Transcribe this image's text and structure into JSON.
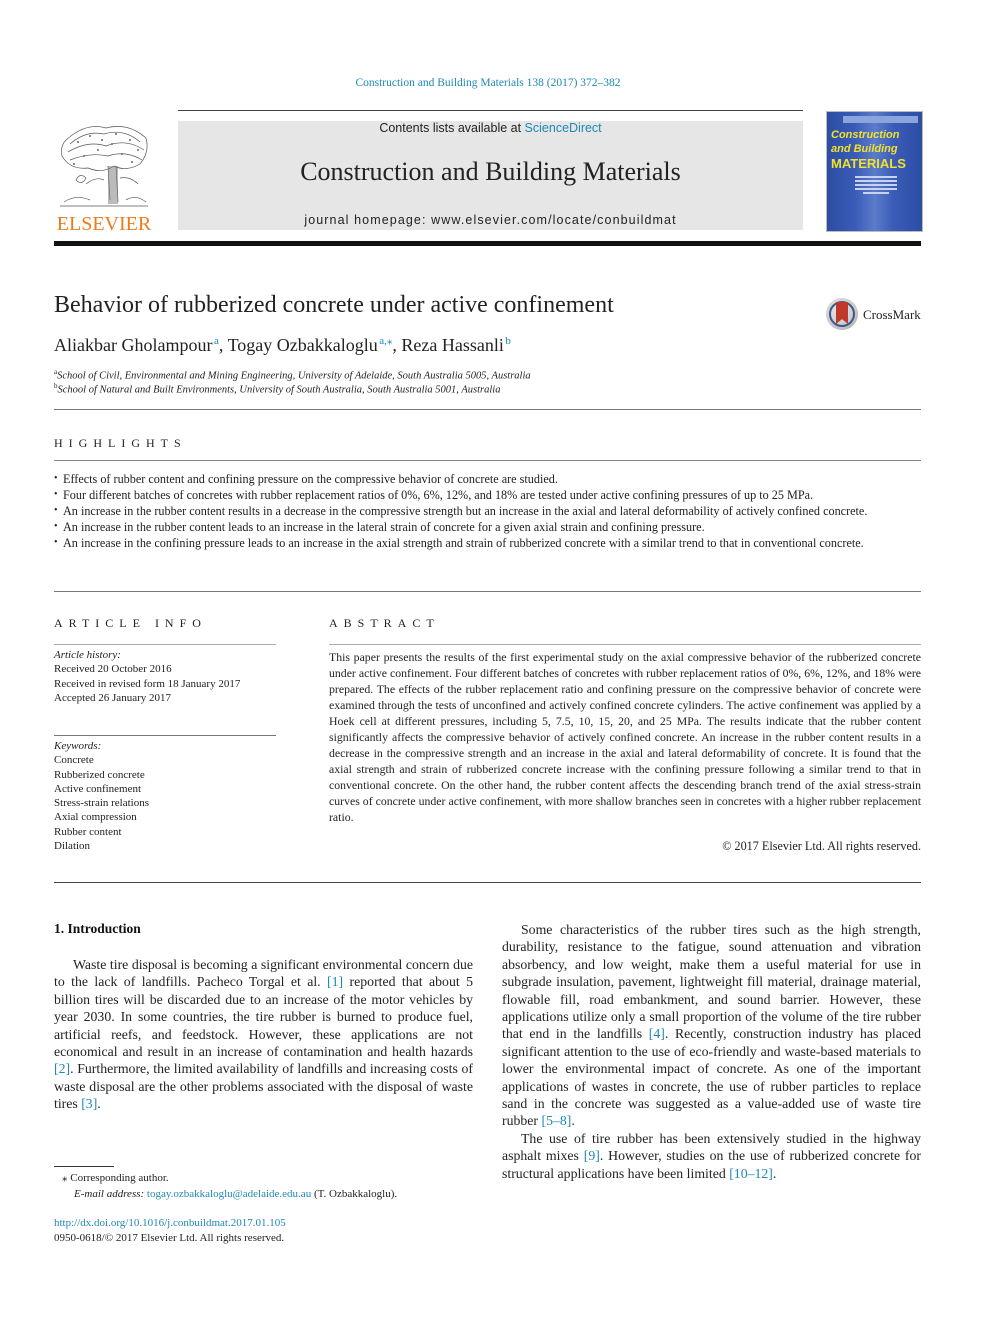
{
  "running_head": "Construction and Building Materials 138 (2017) 372–382",
  "masthead": {
    "contents_prefix": "Contents lists available at ",
    "contents_link": "ScienceDirect",
    "journal_name": "Construction and Building Materials",
    "homepage_label": "journal homepage: www.elsevier.com/locate/conbuildmat",
    "publisher_logo_text": "ELSEVIER",
    "cover": {
      "line1": "Construction",
      "line2": "and Building",
      "line3": "MATERIALS"
    }
  },
  "crossmark_label": "CrossMark",
  "article": {
    "title": "Behavior of rubberized concrete under active confinement",
    "authors": [
      {
        "name": "Aliakbar Gholampour",
        "sup": "a"
      },
      {
        "name": "Togay Ozbakkaloglu",
        "sup": "a,⁎"
      },
      {
        "name": "Reza Hassanli",
        "sup": "b"
      }
    ],
    "affiliations": [
      {
        "sup": "a",
        "text": "School of Civil, Environmental and Mining Engineering, University of Adelaide, South Australia 5005, Australia"
      },
      {
        "sup": "b",
        "text": "School of Natural and Built Environments, University of South Australia, South Australia 5001, Australia"
      }
    ]
  },
  "highlights": {
    "label": "HIGHLIGHTS",
    "items": [
      "Effects of rubber content and confining pressure on the compressive behavior of concrete are studied.",
      "Four different batches of concretes with rubber replacement ratios of 0%, 6%, 12%, and 18% are tested under active confining pressures of up to 25 MPa.",
      "An increase in the rubber content results in a decrease in the compressive strength but an increase in the axial and lateral deformability of actively confined concrete.",
      "An increase in the rubber content leads to an increase in the lateral strain of concrete for a given axial strain and confining pressure.",
      "An increase in the confining pressure leads to an increase in the axial strength and strain of rubberized concrete with a similar trend to that in conventional concrete."
    ]
  },
  "article_info": {
    "label": "ARTICLE INFO",
    "history_label": "Article history:",
    "history": [
      "Received 20 October 2016",
      "Received in revised form 18 January 2017",
      "Accepted 26 January 2017"
    ],
    "keywords_label": "Keywords:",
    "keywords": [
      "Concrete",
      "Rubberized concrete",
      "Active confinement",
      "Stress-strain relations",
      "Axial compression",
      "Rubber content",
      "Dilation"
    ]
  },
  "abstract": {
    "label": "ABSTRACT",
    "text": "This paper presents the results of the first experimental study on the axial compressive behavior of the rubberized concrete under active confinement. Four different batches of concretes with rubber replacement ratios of 0%, 6%, 12%, and 18% were prepared. The effects of the rubber replacement ratio and confining pressure on the compressive behavior of concrete were examined through the tests of unconfined and actively confined concrete cylinders. The active confinement was applied by a Hoek cell at different pressures, including 5, 7.5, 10, 15, 20, and 25 MPa. The results indicate that the rubber content significantly affects the compressive behavior of actively confined concrete. An increase in the rubber content results in a decrease in the compressive strength and an increase in the axial and lateral deformability of concrete. It is found that the axial strength and strain of rubberized concrete increase with the confining pressure following a similar trend to that in conventional concrete. On the other hand, the rubber content affects the descending branch trend of the axial stress-strain curves of concrete under active confinement, with more shallow branches seen in concretes with a higher rubber replacement ratio.",
    "copyright": "© 2017 Elsevier Ltd. All rights reserved."
  },
  "introduction": {
    "heading": "1. Introduction",
    "p1": {
      "a": "Waste tire disposal is becoming a significant environmental concern due to the lack of landfills. Pacheco Torgal et al. ",
      "ref1": "[1]",
      "b": " reported that about 5 billion tires will be discarded due to an increase of the motor vehicles by year 2030. In some countries, the tire rubber is burned to produce fuel, artificial reefs, and feedstock. However, these applications are not economical and result in an increase of contamination and health hazards ",
      "ref2": "[2]",
      "c": ". Furthermore, the limited availability of landfills and increasing costs of waste disposal are the other problems associated with the disposal of waste tires ",
      "ref3": "[3]",
      "d": "."
    },
    "p2": {
      "a": "Some characteristics of the rubber tires such as the high strength, durability, resistance to the fatigue, sound attenuation and vibration absorbency, and low weight, make them a useful material for use in subgrade insulation, pavement, lightweight fill material, drainage material, flowable fill, road embankment, and sound barrier. However, these applications utilize only a small proportion of the volume of the tire rubber that end in the landfills ",
      "ref1": "[4]",
      "b": ". Recently, construction industry has placed significant attention to the use of eco-friendly and waste-based materials to lower the environmental impact of concrete. As one of the important applications of wastes in concrete, the use of rubber particles to replace sand in the concrete was suggested as a value-added use of waste tire rubber ",
      "ref2": "[5–8]",
      "c": "."
    },
    "p3": {
      "a": "The use of tire rubber has been extensively studied in the highway asphalt mixes ",
      "ref1": "[9]",
      "b": ". However, studies on the use of rubberized concrete for structural applications have been limited ",
      "ref2": "[10–12]",
      "c": "."
    }
  },
  "footnote": {
    "marker": "⁎",
    "corresponding": "Corresponding author.",
    "email_label": "E-mail address: ",
    "email": "togay.ozbakkaloglu@adelaide.edu.au",
    "email_suffix": " (T. Ozbakkaloglu)."
  },
  "doi": {
    "url": "http://dx.doi.org/10.1016/j.conbuildmat.2017.01.105",
    "issn_line": "0950-0618/© 2017 Elsevier Ltd. All rights reserved."
  },
  "colors": {
    "link": "#1e88b4",
    "elsevier_orange": "#f07a1a",
    "masthead_bg": "#e6e6e6",
    "cover_blue": "#2d4da3",
    "cover_yellow": "#f2e12c"
  }
}
